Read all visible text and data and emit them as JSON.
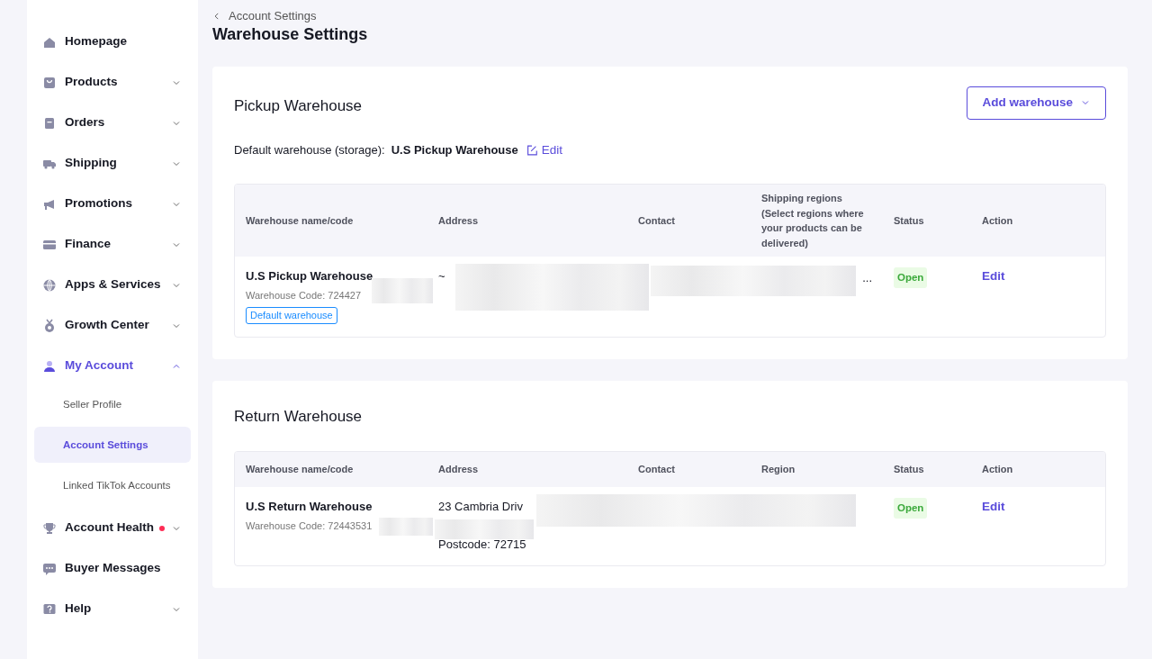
{
  "sidebar": {
    "items": [
      {
        "label": "Homepage",
        "kind": "link",
        "selected": false
      },
      {
        "label": "Products",
        "kind": "group",
        "expanded": false,
        "selected": false
      },
      {
        "label": "Orders",
        "kind": "group",
        "expanded": false,
        "selected": false
      },
      {
        "label": "Shipping",
        "kind": "group",
        "expanded": false,
        "selected": false
      },
      {
        "label": "Promotions",
        "kind": "group",
        "expanded": false,
        "selected": false
      },
      {
        "label": "Finance",
        "kind": "group",
        "expanded": false,
        "selected": false
      },
      {
        "label": "Apps & Services",
        "kind": "group",
        "expanded": false,
        "selected": false
      },
      {
        "label": "Growth Center",
        "kind": "group",
        "expanded": false,
        "selected": false
      },
      {
        "label": "My Account",
        "kind": "group",
        "expanded": true,
        "selected": true,
        "children": [
          {
            "label": "Seller Profile",
            "selected": false
          },
          {
            "label": "Account Settings",
            "selected": true
          },
          {
            "label": "Linked TikTok Accounts",
            "selected": false
          }
        ]
      },
      {
        "label": "Account Health",
        "kind": "group",
        "expanded": false,
        "selected": false,
        "alert": true
      },
      {
        "label": "Buyer Messages",
        "kind": "link",
        "selected": false
      },
      {
        "label": "Help",
        "kind": "group",
        "expanded": false,
        "selected": false
      }
    ]
  },
  "breadcrumb": "Account Settings",
  "page_title": "Warehouse Settings",
  "pickup": {
    "title": "Pickup Warehouse",
    "add_button": "Add warehouse",
    "default_label": "Default warehouse (storage):",
    "default_name": "U.S Pickup Warehouse",
    "edit_link": "Edit",
    "table": {
      "columns": [
        "Warehouse name/code",
        "Address",
        "Contact",
        "Shipping regions (Select regions where your products can be delivered)",
        "Status",
        "Action"
      ],
      "rows": [
        {
          "name": "U.S Pickup Warehouse",
          "code": "Warehouse Code: 724427",
          "tag": "Default warehouse",
          "address": [
            "~"
          ],
          "region": "...",
          "status": "Open",
          "action": "Edit"
        }
      ]
    }
  },
  "return": {
    "title": "Return Warehouse",
    "table": {
      "columns": [
        "Warehouse name/code",
        "Address",
        "Contact",
        "Region",
        "Status",
        "Action"
      ],
      "rows": [
        {
          "name": "U.S Return Warehouse",
          "code": "Warehouse Code: 72443531",
          "address": [
            "23 Cambria Driv",
            "Postcode: 72715"
          ],
          "region": "",
          "status": "Open",
          "action": "Edit"
        }
      ]
    }
  }
}
